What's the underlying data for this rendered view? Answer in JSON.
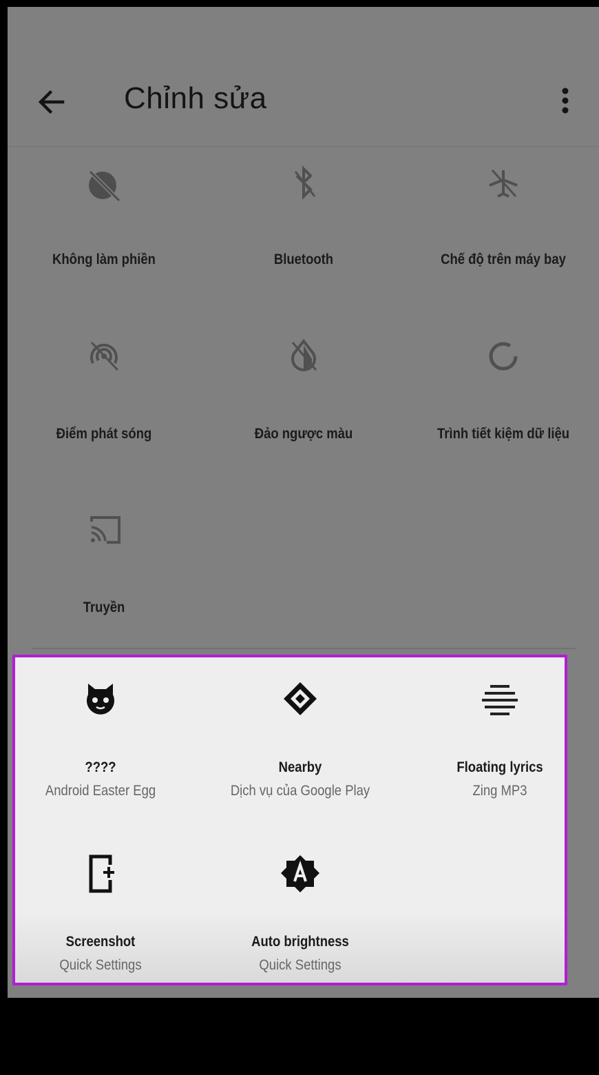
{
  "header": {
    "title": "Chỉnh sửa"
  },
  "active_tiles": [
    {
      "label": "Không làm phiền",
      "icon": "do-not-disturb-off-icon"
    },
    {
      "label": "Bluetooth",
      "icon": "bluetooth-off-icon"
    },
    {
      "label": "Chế độ trên máy bay",
      "icon": "airplane-off-icon"
    },
    {
      "label": "Điểm phát sóng",
      "icon": "hotspot-off-icon"
    },
    {
      "label": "Đảo ngược màu",
      "icon": "invert-colors-off-icon"
    },
    {
      "label": "Trình tiết kiệm dữ liệu",
      "icon": "data-saver-icon"
    },
    {
      "label": "Truyền",
      "icon": "cast-icon"
    }
  ],
  "available_tiles": [
    {
      "label": "????",
      "sub": "Android Easter Egg",
      "icon": "cat-face-icon"
    },
    {
      "label": "Nearby",
      "sub": "Dịch vụ của Google Play",
      "icon": "nearby-icon"
    },
    {
      "label": "Floating lyrics",
      "sub": "Zing MP3",
      "icon": "lyrics-lines-icon"
    },
    {
      "label": "Screenshot",
      "sub": "Quick Settings",
      "icon": "screenshot-icon"
    },
    {
      "label": "Auto brightness",
      "sub": "Quick Settings",
      "icon": "auto-brightness-icon"
    }
  ],
  "colors": {
    "highlight_border": "#b21ed6",
    "dim_overlay": "#808080",
    "panel": "#eeeeee"
  }
}
